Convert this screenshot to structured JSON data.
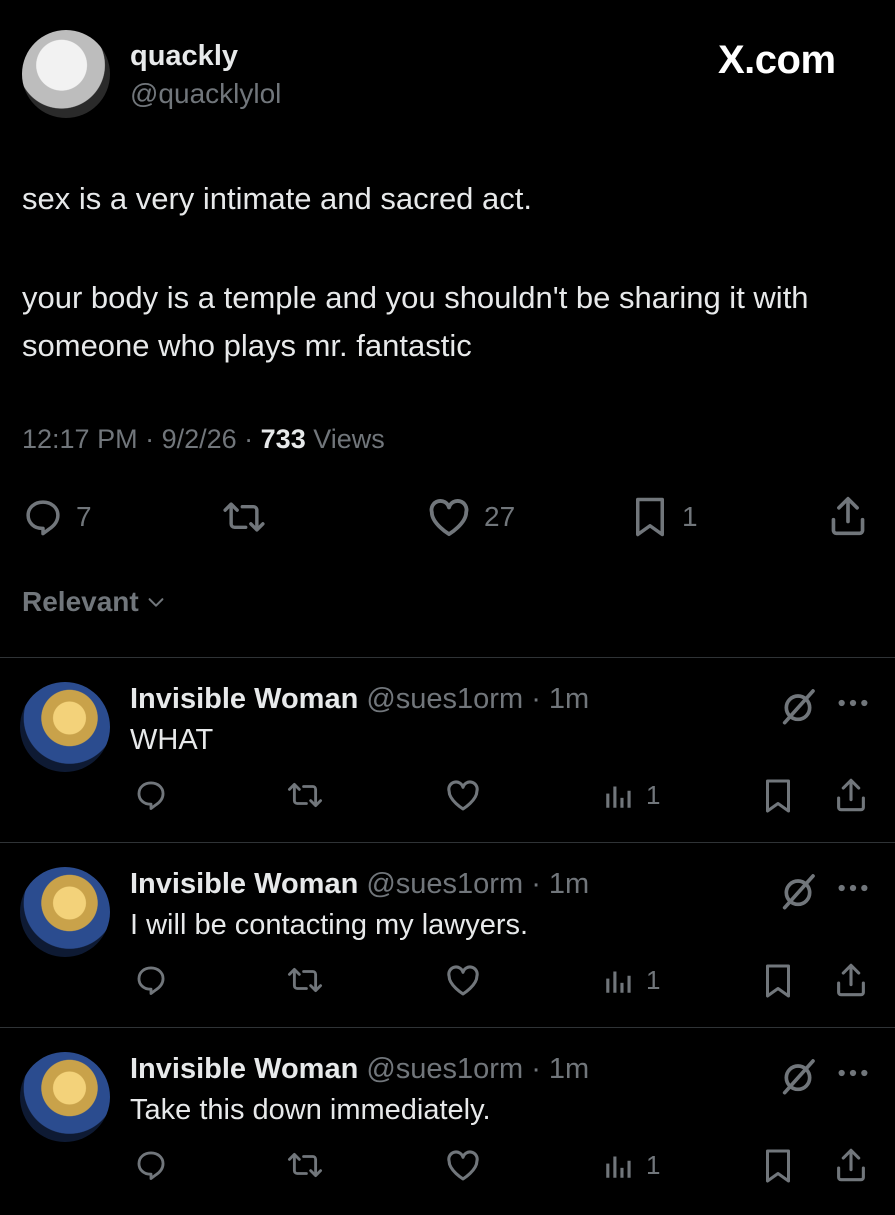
{
  "post": {
    "author_name": "quackly",
    "author_handle": "@quacklylol",
    "brand": "X.com",
    "text_line1": "sex is a very intimate and sacred act.",
    "text_line2": "your body is a temple and you shouldn't be sharing it with someone who plays mr. fantastic",
    "time": "12:17 PM",
    "date": "9/2/26",
    "views_count": "733",
    "views_label": "Views",
    "replies": "7",
    "likes": "27",
    "bookmarks": "1"
  },
  "sort": {
    "label": "Relevant"
  },
  "replies": [
    {
      "name": "Invisible Woman",
      "handle": "@sues1orm",
      "time": "1m",
      "text": "WHAT",
      "views": "1"
    },
    {
      "name": "Invisible Woman",
      "handle": "@sues1orm",
      "time": "1m",
      "text": "I will be contacting my lawyers.",
      "views": "1"
    },
    {
      "name": "Invisible Woman",
      "handle": "@sues1orm",
      "time": "1m",
      "text": "Take this down immediately.",
      "views": "1"
    }
  ],
  "icons": {
    "reply": "reply-icon",
    "repost": "repost-icon",
    "like": "heart-icon",
    "bookmark": "bookmark-icon",
    "share": "share-icon",
    "views": "views-icon",
    "mute": "grok-icon",
    "more": "more-icon"
  },
  "colors": {
    "background": "#000000",
    "text": "#e7e9ea",
    "muted": "#71767b",
    "divider": "#2f3336"
  }
}
